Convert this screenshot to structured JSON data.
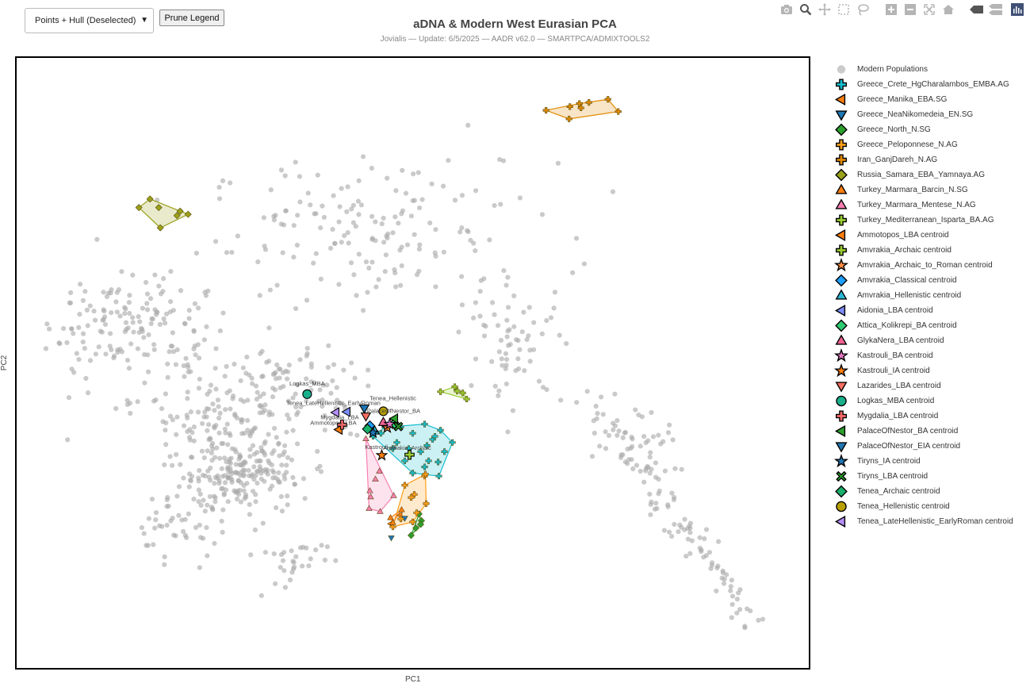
{
  "controls": {
    "view_select": "Points + Hull (Deselected)",
    "prune_label": "Prune Legend"
  },
  "modebar_icons": [
    "camera-icon",
    "zoom-icon",
    "pan-icon",
    "box-select-icon",
    "lasso-icon",
    "zoom-in-icon",
    "zoom-out-icon",
    "autoscale-icon",
    "reset-icon",
    "hover-closest-icon",
    "hover-compare-icon",
    "plotly-logo-icon"
  ],
  "chart_data": {
    "type": "scatter",
    "title": "aDNA & Modern West Eurasian PCA",
    "subtitle": "Jovialis — Update: 6/5/2025 — AADR v62.0 — SMARTPCA/ADMIXTOOLS2",
    "xlabel": "PC1",
    "ylabel": "PC2",
    "xlim": [
      0,
      100
    ],
    "ylim": [
      0,
      100
    ],
    "grid": false,
    "legend_position": "right",
    "modern_color": "#a9a9a9",
    "modern_clusters": [
      {
        "cx": 46,
        "cy": 71,
        "sx": 11,
        "sy": 6,
        "n": 170
      },
      {
        "cx": 14,
        "cy": 57,
        "sx": 5,
        "sy": 4,
        "n": 140
      },
      {
        "cx": 24,
        "cy": 44,
        "sx": 7,
        "sy": 5,
        "n": 130
      },
      {
        "cx": 28,
        "cy": 32,
        "sx": 4,
        "sy": 3.5,
        "n": 230
      },
      {
        "cx": 20,
        "cy": 23,
        "sx": 3,
        "sy": 2.5,
        "n": 40
      },
      {
        "cx": 35,
        "cy": 18,
        "sx": 2.5,
        "sy": 2.5,
        "n": 30
      },
      {
        "cx": 63,
        "cy": 52,
        "sx": 3,
        "sy": 4,
        "n": 60
      },
      {
        "cx": 36,
        "cy": 46,
        "sx": 5,
        "sy": 4,
        "n": 70
      },
      {
        "cx": 79,
        "cy": 38,
        "sx": 2.5,
        "sy": 3,
        "n": 30
      }
    ],
    "modern_line": {
      "from": [
        72,
        44
      ],
      "to": [
        94,
        6
      ],
      "spread": 2.6,
      "n": 110
    },
    "series": [
      {
        "name": "Greece_Crete_HgCharalambos_EMBA.AG",
        "symbol": "cross-thin",
        "color": "#17becf",
        "hull": true,
        "points": [
          [
            45,
            38
          ],
          [
            46.5,
            39.5
          ],
          [
            48,
            37
          ],
          [
            50,
            38.5
          ],
          [
            51.5,
            40
          ],
          [
            52.5,
            37.5
          ],
          [
            53.5,
            39
          ],
          [
            51,
            35.5
          ],
          [
            54,
            35.5
          ],
          [
            49,
            34
          ],
          [
            51.5,
            33
          ],
          [
            53.3,
            31.5
          ],
          [
            50,
            32
          ],
          [
            52.8,
            38
          ],
          [
            47.5,
            36
          ],
          [
            46,
            38.5
          ],
          [
            55,
            37
          ],
          [
            52,
            34
          ],
          [
            49.5,
            36
          ],
          [
            48.5,
            39.5
          ],
          [
            51.8,
            36.5
          ],
          [
            53.2,
            33.8
          ]
        ]
      },
      {
        "name": "Greece_Manika_EBA.SG",
        "symbol": "triangle-left",
        "color": "#ff7f0e",
        "hull": false,
        "points": [
          [
            48.4,
            25.1
          ],
          [
            47.2,
            23.7
          ]
        ]
      },
      {
        "name": "Greece_NeaNikomedeia_EN.SG",
        "symbol": "triangle-down",
        "color": "#1f77b4",
        "hull": false,
        "points": [
          [
            47.3,
            21.4
          ],
          [
            49.0,
            24.6
          ]
        ]
      },
      {
        "name": "Greece_North_N.SG",
        "symbol": "diamond",
        "color": "#2ca02c",
        "hull": true,
        "points": [
          [
            49.8,
            21.8
          ],
          [
            50.8,
            25.3
          ],
          [
            51.1,
            24.2
          ],
          [
            50.4,
            23.0
          ],
          [
            51.0,
            23.6
          ]
        ]
      },
      {
        "name": "Greece_Peloponnese_N.AG",
        "symbol": "cross",
        "color": "#ff9f1a",
        "hull": true,
        "points": [
          [
            51.5,
            31.5
          ],
          [
            49,
            30
          ],
          [
            50.2,
            28.5
          ],
          [
            51.7,
            27
          ],
          [
            50.5,
            25.5
          ],
          [
            48.5,
            24.5
          ],
          [
            47.5,
            23.2
          ],
          [
            50,
            24
          ],
          [
            51.6,
            31.8
          ],
          [
            49.8,
            28
          ]
        ]
      },
      {
        "name": "Iran_GanjDareh_N.AG",
        "symbol": "cross",
        "color": "#e08a00",
        "hull": true,
        "points": [
          [
            66.8,
            91.3
          ],
          [
            69.8,
            91.9
          ],
          [
            71.0,
            92.4
          ],
          [
            71.2,
            91.7
          ],
          [
            72.2,
            92.6
          ],
          [
            74.6,
            93.1
          ],
          [
            75.9,
            91.1
          ],
          [
            69.7,
            89.9
          ]
        ]
      },
      {
        "name": "Russia_Samara_EBA_Yamnaya.AG",
        "symbol": "diamond",
        "color": "#9aa019",
        "hull": true,
        "points": [
          [
            16.9,
            76.8
          ],
          [
            15.5,
            75.4
          ],
          [
            18.0,
            75.4
          ],
          [
            20.7,
            74.8
          ],
          [
            21.7,
            74.3
          ],
          [
            20.3,
            74.1
          ],
          [
            18.2,
            72.1
          ]
        ]
      },
      {
        "name": "Turkey_Marmara_Barcin_N.SG",
        "symbol": "triangle-up",
        "color": "#ff7f0e",
        "hull": true,
        "points": [
          [
            47.2,
            24.7
          ],
          [
            48.6,
            26.0
          ],
          [
            47.5,
            23.9
          ]
        ]
      },
      {
        "name": "Turkey_Marmara_Mentese_N.AG",
        "symbol": "triangle-up",
        "color": "#f77fb0",
        "hull": true,
        "points": [
          [
            44.1,
            37.6
          ],
          [
            45.8,
            32.3
          ],
          [
            44.6,
            29.1
          ],
          [
            44.7,
            28.1
          ],
          [
            44.5,
            26.2
          ],
          [
            47.6,
            28.3
          ],
          [
            45.9,
            25.7
          ],
          [
            45.3,
            31.0
          ]
        ]
      },
      {
        "name": "Turkey_Mediterranean_Isparta_BA.AG",
        "symbol": "cross",
        "color": "#9acd32",
        "hull": true,
        "points": [
          [
            53.5,
            45.3
          ],
          [
            55.3,
            46.1
          ],
          [
            56.3,
            45.1
          ],
          [
            56.8,
            44.1
          ],
          [
            55.6,
            45.4
          ]
        ]
      },
      {
        "name": "Ammotopos_LBA centroid",
        "symbol": "triangle-left",
        "color": "#ff7f0e",
        "hull": false,
        "label": "Ammotopos_LBA",
        "points": [
          [
            40.7,
            39.1
          ]
        ]
      },
      {
        "name": "Amvrakia_Archaic centroid",
        "symbol": "cross",
        "color": "#9acd32",
        "hull": false,
        "label": "Amvrakia_Archaic",
        "points": [
          [
            49.6,
            35.0
          ]
        ]
      },
      {
        "name": "Amvrakia_Archaic_to_Roman centroid",
        "symbol": "star",
        "color": "#ff8c42",
        "hull": false,
        "points": [
          [
            46.8,
            39.4
          ]
        ]
      },
      {
        "name": "Amvrakia_Classical centroid",
        "symbol": "diamond",
        "color": "#1f9fff",
        "hull": false,
        "points": [
          [
            44.6,
            39.7
          ]
        ]
      },
      {
        "name": "Amvrakia_Hellenistic centroid",
        "symbol": "triangle-up",
        "color": "#29b8d6",
        "hull": false,
        "points": [
          [
            45.2,
            38.9
          ]
        ]
      },
      {
        "name": "Aidonia_LBA centroid",
        "symbol": "triangle-left",
        "color": "#7b8cf7",
        "hull": false,
        "points": [
          [
            41.7,
            42.0
          ]
        ]
      },
      {
        "name": "Attica_Kolikrepi_BA centroid",
        "symbol": "diamond",
        "color": "#2ecc71",
        "hull": false,
        "points": [
          [
            47.7,
            40.1
          ]
        ]
      },
      {
        "name": "GlykaNera_LBA centroid",
        "symbol": "triangle-up",
        "color": "#f06292",
        "hull": false,
        "points": [
          [
            46.3,
            40.3
          ]
        ]
      },
      {
        "name": "Kastrouli_BA centroid",
        "symbol": "star",
        "color": "#e377c2",
        "hull": false,
        "points": [
          [
            47.1,
            40.0
          ]
        ]
      },
      {
        "name": "Kastrouli_IA centroid",
        "symbol": "star",
        "color": "#ff7f0e",
        "hull": false,
        "label": "Kastrouli_IA",
        "points": [
          [
            46.1,
            34.9
          ]
        ]
      },
      {
        "name": "Lazarides_LBA centroid",
        "symbol": "triangle-down",
        "color": "#ff6f61",
        "hull": false,
        "points": [
          [
            44.1,
            41.3
          ]
        ]
      },
      {
        "name": "Logkas_MBA centroid",
        "symbol": "circle",
        "color": "#1aaf8b",
        "hull": false,
        "label": "Logkas_MBA",
        "points": [
          [
            36.7,
            44.9
          ]
        ]
      },
      {
        "name": "Mygdalia_LBA centroid",
        "symbol": "cross",
        "color": "#ff6b6b",
        "hull": false,
        "label": "Mygdalia_LBA",
        "points": [
          [
            41.1,
            39.9
          ]
        ]
      },
      {
        "name": "PalaceOfNestor_BA centroid",
        "symbol": "triangle-left",
        "color": "#2ca02c",
        "hull": false,
        "label": "PalaceOfNestor_BA",
        "points": [
          [
            47.7,
            40.9
          ]
        ]
      },
      {
        "name": "PalaceOfNestor_EIA centroid",
        "symbol": "triangle-down",
        "color": "#1f77b4",
        "hull": false,
        "points": [
          [
            43.9,
            42.6
          ]
        ]
      },
      {
        "name": "Tiryns_IA centroid",
        "symbol": "star",
        "color": "#1f77b4",
        "hull": false,
        "points": [
          [
            45.0,
            38.6
          ]
        ]
      },
      {
        "name": "Tiryns_LBA centroid",
        "symbol": "x",
        "color": "#2ca02c",
        "hull": false,
        "points": [
          [
            48.2,
            39.6
          ]
        ]
      },
      {
        "name": "Tenea_Archaic centroid",
        "symbol": "diamond",
        "color": "#1aaf6b",
        "hull": false,
        "points": [
          [
            44.3,
            39.2
          ]
        ]
      },
      {
        "name": "Tenea_Hellenistic centroid",
        "symbol": "circle",
        "color": "#b8a000",
        "hull": false,
        "label": "Tenea_Hellenistic",
        "points": [
          [
            46.3,
            42.1
          ]
        ]
      },
      {
        "name": "Tenea_LateHellenistic_EarlyRoman centroid",
        "symbol": "triangle-left",
        "color": "#b48ef7",
        "hull": false,
        "label": "Tenea_LateHellenistic_EarlyRoman",
        "points": [
          [
            40.3,
            41.9
          ]
        ]
      }
    ],
    "modern_legend": "Modern Populations",
    "point_labels": [
      {
        "text": "Logkas_MBA",
        "x": 36.7,
        "y": 46.3
      },
      {
        "text": "Tenea_LateHellenistic_EarlyRoman",
        "x": 40.0,
        "y": 43.1
      },
      {
        "text": "Tenea_Hellenistic",
        "x": 47.5,
        "y": 43.9
      },
      {
        "text": "PalaceOfNestor_BA",
        "x": 47.6,
        "y": 41.8
      },
      {
        "text": "Mygdalia_LBA",
        "x": 40.8,
        "y": 40.8
      },
      {
        "text": "Ammotopos_LBA",
        "x": 40.0,
        "y": 39.9
      },
      {
        "text": "Kastrouli_IA",
        "x": 46.0,
        "y": 35.9
      },
      {
        "text": "Amvrakia_Archaic",
        "x": 49.3,
        "y": 35.8
      }
    ]
  }
}
